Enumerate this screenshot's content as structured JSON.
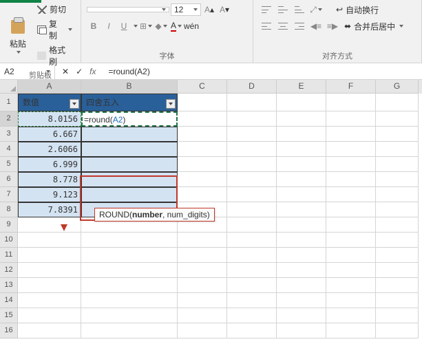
{
  "ribbon": {
    "clipboard": {
      "label": "剪贴板",
      "paste": "粘贴",
      "cut": "剪切",
      "copy": "复制",
      "brush": "格式刷"
    },
    "font": {
      "label": "字体",
      "name_placeholder": "",
      "size_placeholder": "12",
      "b": "B",
      "i": "I",
      "u": "U"
    },
    "align": {
      "label": "对齐方式",
      "wrap": "自动换行",
      "merge": "合并后居中"
    }
  },
  "formula_bar": {
    "cell_ref": "A2",
    "fx": "fx",
    "formula": "=round(A2)"
  },
  "columns": [
    "A",
    "B",
    "C",
    "D",
    "E",
    "F",
    "G"
  ],
  "headers": {
    "A": "数值",
    "B": "四舍五入"
  },
  "data_rows": [
    {
      "n": 2,
      "A": "8.0156",
      "B": "=round(A2)"
    },
    {
      "n": 3,
      "A": "6.667",
      "B": ""
    },
    {
      "n": 4,
      "A": "2.6066",
      "B": ""
    },
    {
      "n": 5,
      "A": "6.999",
      "B": ""
    },
    {
      "n": 6,
      "A": "8.778",
      "B": ""
    },
    {
      "n": 7,
      "A": "9.123",
      "B": ""
    },
    {
      "n": 8,
      "A": "7.8391",
      "B": ""
    }
  ],
  "empty_rows": [
    9,
    10,
    11,
    12,
    13,
    14,
    15,
    16
  ],
  "tooltip": {
    "fn": "ROUND(",
    "arg1": "number",
    "rest": ", num_digits)"
  },
  "active_formula": {
    "prefix": "=round(",
    "ref": "A2",
    "suffix": ")"
  },
  "chart_data": {
    "type": "table",
    "columns": [
      "数值",
      "四舍五入"
    ],
    "rows": [
      [
        8.0156,
        null
      ],
      [
        6.667,
        null
      ],
      [
        2.6066,
        null
      ],
      [
        6.999,
        null
      ],
      [
        8.778,
        null
      ],
      [
        9.123,
        null
      ],
      [
        7.8391,
        null
      ]
    ],
    "active_cell": "B2",
    "formula": "=round(A2)"
  }
}
